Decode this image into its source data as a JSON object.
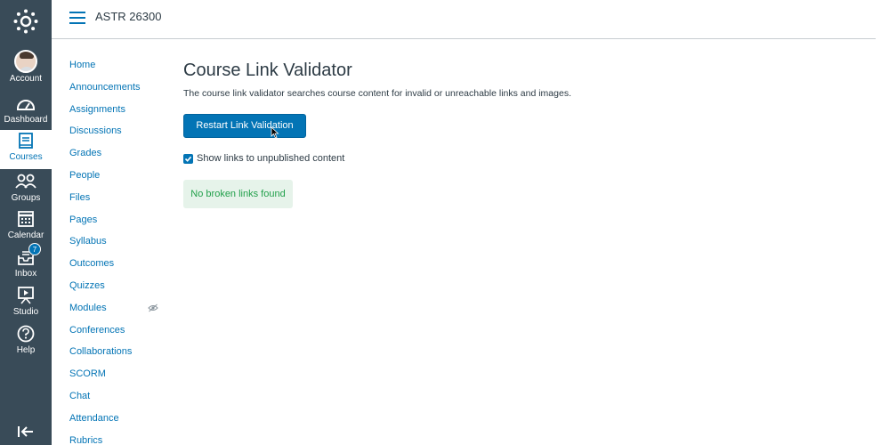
{
  "global_nav": {
    "items": [
      {
        "label": "Account",
        "icon": "avatar"
      },
      {
        "label": "Dashboard",
        "icon": "dashboard-icon"
      },
      {
        "label": "Courses",
        "icon": "courses-icon",
        "active": true
      },
      {
        "label": "Groups",
        "icon": "groups-icon"
      },
      {
        "label": "Calendar",
        "icon": "calendar-icon"
      },
      {
        "label": "Inbox",
        "icon": "inbox-icon",
        "badge": "7"
      },
      {
        "label": "Studio",
        "icon": "studio-icon"
      },
      {
        "label": "Help",
        "icon": "help-icon"
      }
    ]
  },
  "header": {
    "breadcrumb": "ASTR 26300"
  },
  "course_nav": {
    "items": [
      "Home",
      "Announcements",
      "Assignments",
      "Discussions",
      "Grades",
      "People",
      "Files",
      "Pages",
      "Syllabus",
      "Outcomes",
      "Quizzes",
      "Modules",
      "Conferences",
      "Collaborations",
      "SCORM",
      "Chat",
      "Attendance",
      "Rubrics"
    ]
  },
  "main": {
    "title": "Course Link Validator",
    "description": "The course link validator searches course content for invalid or unreachable links and images.",
    "button_label": "Restart Link Validation",
    "checkbox_label": "Show links to unpublished content",
    "checkbox_checked": true,
    "result": "No broken links found"
  },
  "colors": {
    "nav_bg": "#394b58",
    "accent": "#0374b5",
    "success_text": "#22a04b",
    "success_bg": "#e6f3ea"
  }
}
